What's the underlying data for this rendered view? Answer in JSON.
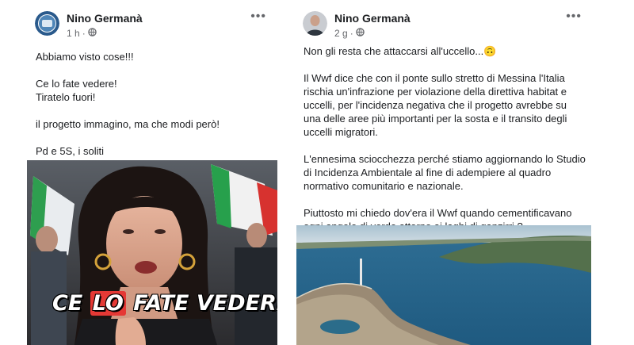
{
  "post1": {
    "author": "Nino Germanà",
    "time": "1 h",
    "more_label": "•••",
    "lines": [
      "Abbiamo visto cose!!!",
      "Ce lo fate vedere!",
      "Tiratelo fuori!",
      "il progetto immagino, ma che modi però!",
      "Pd e 5S, i soliti"
    ],
    "video_caption": {
      "part1": "CE",
      "part2": "LO",
      "part3": "FATE VEDERE?"
    }
  },
  "post2": {
    "author": "Nino Germanà",
    "time": "2 g",
    "more_label": "•••",
    "para1": "Non gli resta che attaccarsi all'uccello...",
    "emoji": "🙃",
    "para2": "Il Wwf dice che con il ponte sullo stretto di Messina l'Italia rischia un'infrazione per violazione della direttiva habitat e uccelli, per l'incidenza negativa che il progetto avrebbe su una delle aree più importanti per la sosta e il transito degli uccelli migratori.",
    "para3": "L'ennesima sciocchezza perché stiamo aggiornando lo Studio di Incidenza Ambientale al fine di adempiere al quadro normativo comunitario e nazionale.",
    "para4": "Piuttosto mi chiedo dov'era il Wwf quando cementificavano ogni angolo di verde attorno ai laghi di ganzirri ?"
  },
  "colors": {
    "text": "#1c1e21",
    "meta": "#65676b",
    "highlight": "#e53935"
  },
  "icons": {
    "privacy": "globe-icon",
    "more": "more-options-icon"
  }
}
